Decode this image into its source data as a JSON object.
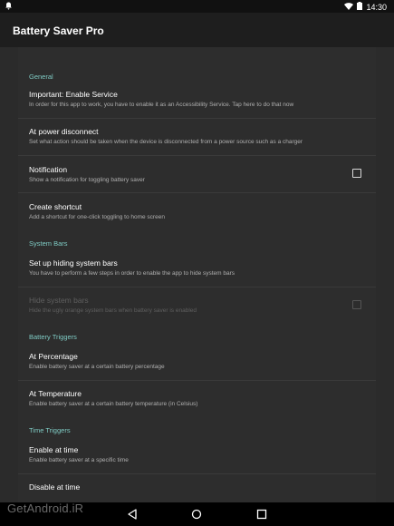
{
  "status_bar": {
    "time": "14:30"
  },
  "app_bar": {
    "title": "Battery Saver Pro"
  },
  "sections": {
    "general": "General",
    "system_bars": "System Bars",
    "battery_triggers": "Battery Triggers",
    "time_triggers": "Time Triggers"
  },
  "prefs": {
    "enable_service": {
      "title": "Important: Enable Service",
      "summary": "In order for this app to work, you have to enable it as an Accessibility Service. Tap here to do that now"
    },
    "power_disconnect": {
      "title": "At power disconnect",
      "summary": "Set what action should be taken when the device is disconnected from a power source such as a charger"
    },
    "notification": {
      "title": "Notification",
      "summary": "Show a notification for toggling battery saver",
      "checked": false
    },
    "create_shortcut": {
      "title": "Create shortcut",
      "summary": "Add a shortcut for one-click toggling to home screen"
    },
    "setup_hiding": {
      "title": "Set up hiding system bars",
      "summary": "You have to perform a few steps in order to enable the app to hide system bars"
    },
    "hide_system_bars": {
      "title": "Hide system bars",
      "summary": "Hide the ugly orange system bars when battery saver is enabled",
      "checked": false,
      "enabled": false
    },
    "at_percentage": {
      "title": "At Percentage",
      "summary": "Enable battery saver at a certain battery percentage"
    },
    "at_temperature": {
      "title": "At Temperature",
      "summary": "Enable battery saver at a certain battery temperature (in Celsius)"
    },
    "enable_at_time": {
      "title": "Enable at time",
      "summary": "Enable battery saver at a specific time"
    },
    "disable_at_time": {
      "title": "Disable at time"
    }
  },
  "watermark": "GetAndroid.iR",
  "colors": {
    "accent": "#7fcbc4",
    "background": "#2d2d2d",
    "app_bar": "#1e1e1e"
  }
}
